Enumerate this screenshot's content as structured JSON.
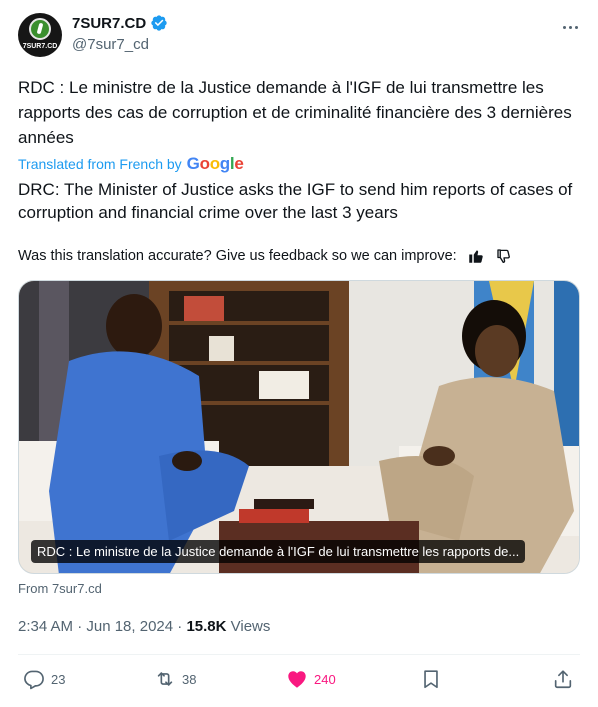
{
  "account": {
    "display_name": "7SUR7.CD",
    "handle": "@7sur7_cd",
    "avatar_text": "7SUR7.CD",
    "verified_color": "#1d9bf0"
  },
  "tweet": {
    "original_text": "RDC : Le ministre de la Justice demande à l'IGF de lui transmettre les rapports des cas de corruption et de criminalité financière des 3 dernières années",
    "translated_label": "Translated from French by",
    "google": [
      "G",
      "o",
      "o",
      "g",
      "l",
      "e"
    ],
    "translated_text": "DRC: The Minister of Justice asks the IGF to send him reports of cases of corruption and financial crime over the last 3 years",
    "feedback_prompt": "Was this translation accurate? Give us feedback so we can improve:",
    "media_caption": "RDC : Le ministre de la Justice demande à l'IGF de lui transmettre les rapports de...",
    "source": "From 7sur7.cd",
    "time": "2:34 AM · Jun 18, 2024 · ",
    "views_count": "15.8K",
    "views_label": " Views"
  },
  "actions": {
    "replies": "23",
    "retweets": "38",
    "likes": "240"
  },
  "colors": {
    "accent": "#1d9bf0",
    "like": "#f91880",
    "muted": "#536471"
  }
}
